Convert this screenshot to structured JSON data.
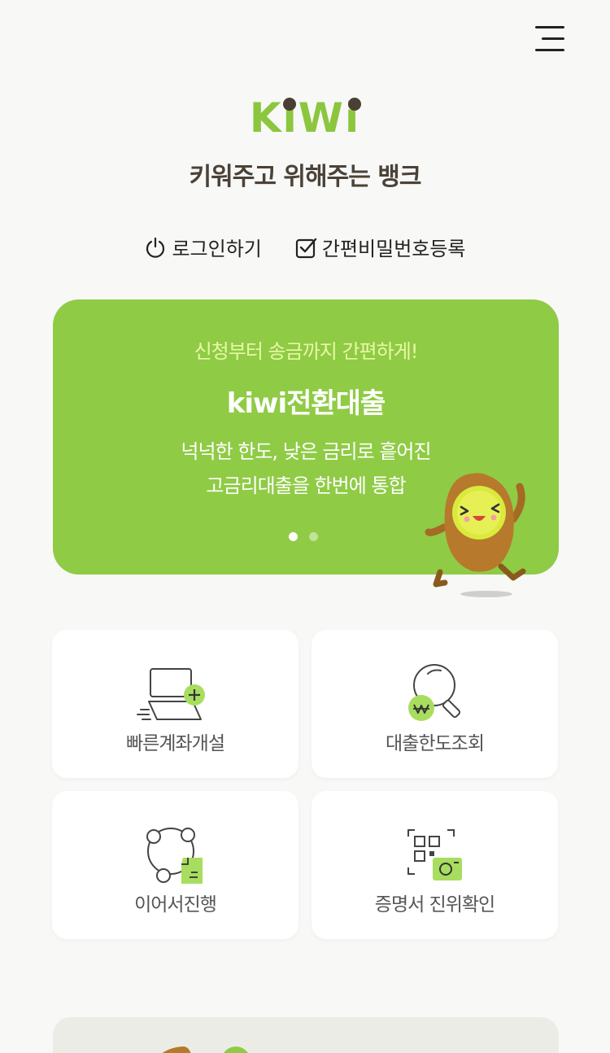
{
  "brand": {
    "logo_text": "KiWi",
    "tagline": "키워주고 위해주는 뱅크",
    "accent_color": "#8fcb45",
    "dark_color": "#4b4237"
  },
  "header": {
    "menu_icon": "hamburger-menu-icon"
  },
  "auth": {
    "login_label": "로그인하기",
    "login_icon": "power-icon",
    "pin_label": "간편비밀번호등록",
    "pin_icon": "checkbox-icon"
  },
  "banner": {
    "subtitle": "신청부터 송금까지 간편하게!",
    "title": "kiwi전환대출",
    "desc_line1": "넉넉한 한도, 낮은 금리로 흩어진",
    "desc_line2": "고금리대출을 한번에 통합",
    "page_count": 2,
    "active_page": 1
  },
  "tiles": [
    {
      "label": "빠른계좌개설",
      "icon": "laptop-plus-icon"
    },
    {
      "label": "대출한도조회",
      "icon": "magnifier-won-icon"
    },
    {
      "label": "이어서진행",
      "icon": "continue-document-icon"
    },
    {
      "label": "증명서 진위확인",
      "icon": "qr-camera-icon"
    }
  ]
}
